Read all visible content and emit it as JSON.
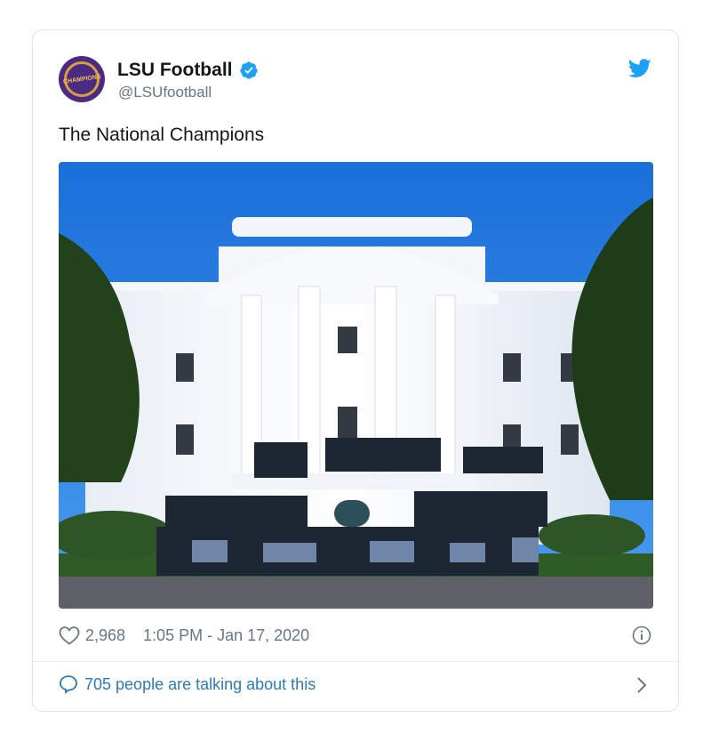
{
  "tweet": {
    "author_name": "LSU Football",
    "handle": "@LSUfootball",
    "avatar_text": "CHAMPIONS",
    "text": "The National Champions",
    "likes": "2,968",
    "timestamp": "1:05 PM - Jan 17, 2020",
    "talking": "705 people are talking about this"
  },
  "icons": {
    "verified": "verified-badge-icon",
    "bird": "twitter-bird-icon",
    "heart": "heart-icon",
    "info": "info-icon",
    "bubble": "speech-bubble-icon",
    "chevron": "chevron-right-icon"
  },
  "colors": {
    "brand_blue": "#1da1f2",
    "link_blue": "#2b7bb9",
    "lsu_purple": "#4b2a83",
    "lsu_gold": "#d6a13a"
  }
}
